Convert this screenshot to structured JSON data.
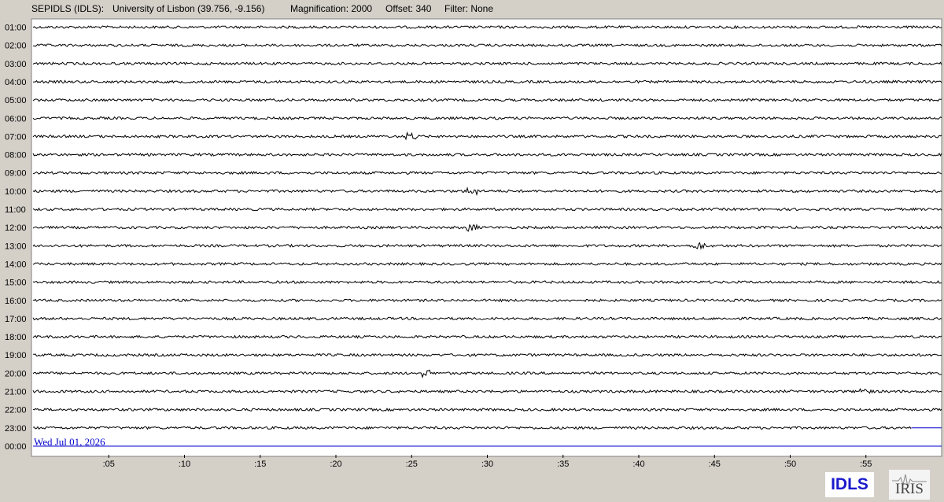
{
  "header": {
    "station": "SEPIDLS (IDLS):",
    "location": "University of Lisbon (39.756, -9.156)",
    "magnification": "Magnification: 2000",
    "offset": "Offset: 340",
    "filter": "Filter: None"
  },
  "logos": {
    "idls": "IDLS",
    "iris": "IRIS"
  },
  "colors": {
    "background": "#d4d0c8",
    "plot_background": "#ffffff",
    "trace": "#000000",
    "current_time_line": "#0000cc",
    "date_label": "#0000cc"
  },
  "chart_data": {
    "type": "line",
    "description_type": "helicorder",
    "date_label": "Wed Jul 01, 2026",
    "rows": [
      "01:00",
      "02:00",
      "03:00",
      "04:00",
      "05:00",
      "06:00",
      "07:00",
      "08:00",
      "09:00",
      "10:00",
      "11:00",
      "12:00",
      "13:00",
      "14:00",
      "15:00",
      "16:00",
      "17:00",
      "18:00",
      "19:00",
      "20:00",
      "21:00",
      "22:00",
      "23:00",
      "00:00"
    ],
    "x_ticks": [
      ":05",
      ":10",
      ":15",
      ":20",
      ":25",
      ":30",
      ":35",
      ":40",
      ":45",
      ":50",
      ":55"
    ],
    "x_tick_minutes": [
      5,
      10,
      15,
      20,
      25,
      30,
      35,
      40,
      45,
      50,
      55
    ],
    "xlim": [
      0,
      60
    ],
    "last_trace_row": "23:00",
    "last_trace_end_minute": 58,
    "events": [
      {
        "row": "07:00",
        "minute": 25
      },
      {
        "row": "12:00",
        "minute": 29
      },
      {
        "row": "13:00",
        "minute": 44
      },
      {
        "row": "20:00",
        "minute": 26
      },
      {
        "row": "21:00",
        "minute": 55
      },
      {
        "row": "10:00",
        "minute": 29
      }
    ]
  }
}
